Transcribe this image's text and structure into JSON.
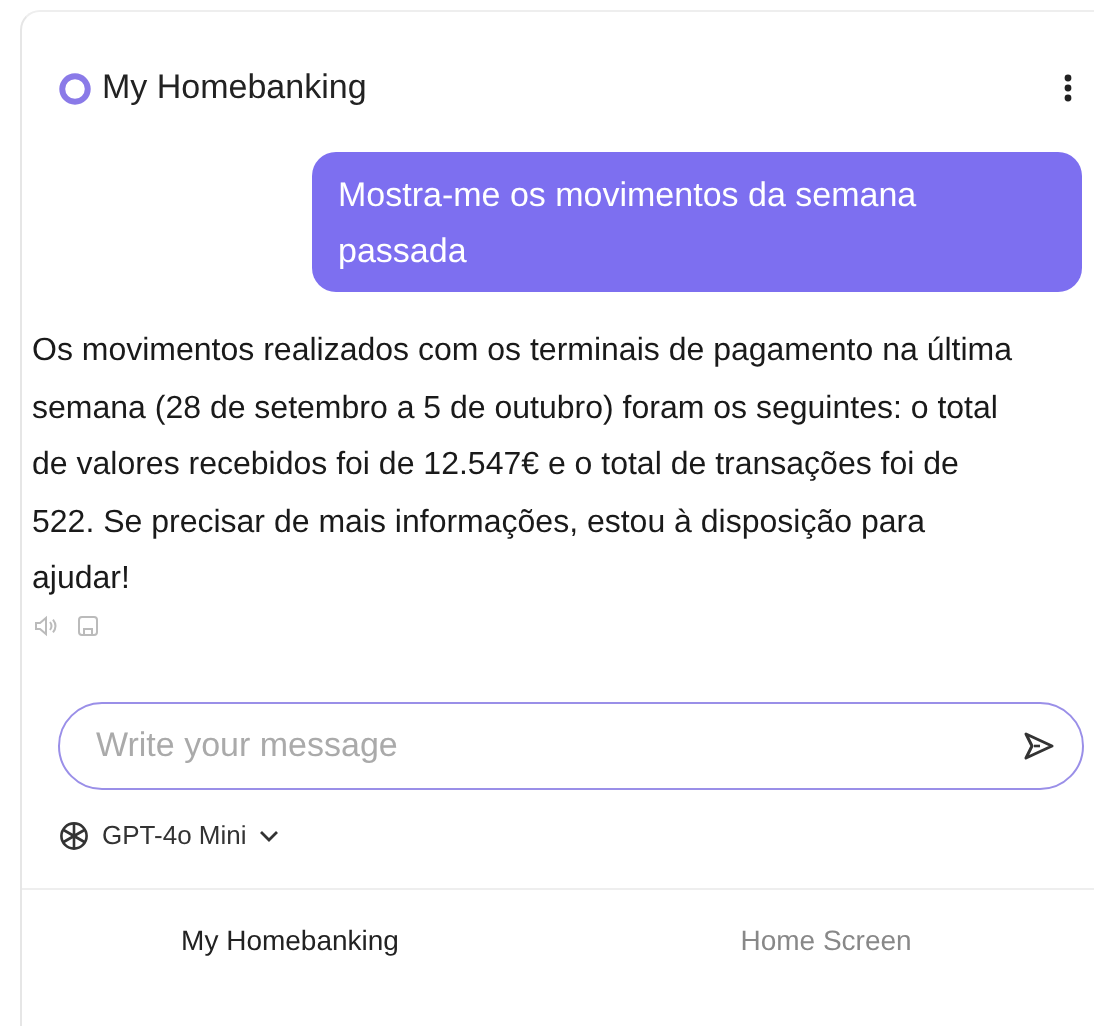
{
  "header": {
    "title": "My Homebanking"
  },
  "messages": [
    {
      "kind": "user",
      "text": "Mostra-me os movimentos da semana passada"
    },
    {
      "kind": "assistant",
      "text": "Os movimentos realizados com os terminais de pagamento na última semana (28 de setembro a 5 de outubro) foram os seguintes: o total de valores recebidos foi de 12.547€ e o total de transações foi de 522. Se precisar de mais informações, estou à disposição para ajudar!"
    }
  ],
  "composer": {
    "placeholder": "Write your message"
  },
  "model": {
    "label": "GPT-4o Mini"
  },
  "tabs": [
    {
      "label": "My Homebanking",
      "selected": true
    },
    {
      "label": "Home Screen",
      "selected": false
    }
  ]
}
